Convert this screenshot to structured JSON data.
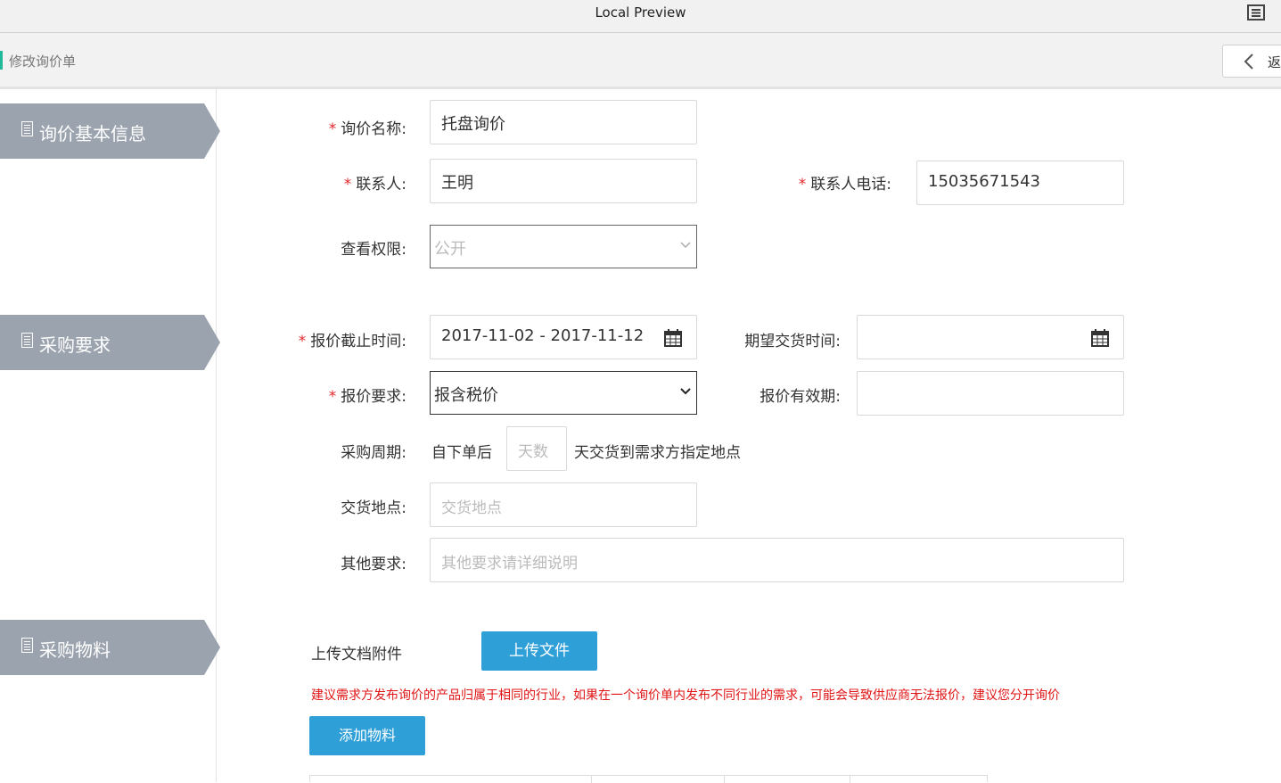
{
  "window": {
    "title": "Local Preview",
    "menu_icon": "list-icon"
  },
  "page": {
    "title": "修改询价单",
    "back_label": "返回"
  },
  "sections": {
    "basic": "询价基本信息",
    "requirements": "采购要求",
    "materials": "采购物料"
  },
  "form": {
    "inquiry_name": {
      "label": "询价名称:",
      "value": "托盘询价"
    },
    "contact": {
      "label": "联系人:",
      "value": "王明"
    },
    "contact_phone": {
      "label": "联系人电话:",
      "value": "15035671543"
    },
    "visibility": {
      "label": "查看权限:",
      "value": "公开"
    },
    "quote_deadline": {
      "label": "报价截止时间:",
      "value": "2017-11-02 - 2017-11-12"
    },
    "expected_delivery": {
      "label": "期望交货时间:",
      "value": ""
    },
    "quote_requirement": {
      "label": "报价要求:",
      "value": "报含税价"
    },
    "quote_validity": {
      "label": "报价有效期:",
      "value": ""
    },
    "purchase_cycle": {
      "label": "采购周期:",
      "prefix": "自下单后",
      "placeholder": "天数",
      "suffix": "天交货到需求方指定地点"
    },
    "delivery_place": {
      "label": "交货地点:",
      "placeholder": "交货地点"
    },
    "other_requirements": {
      "label": "其他要求:",
      "placeholder": "其他要求请详细说明"
    }
  },
  "materials": {
    "upload_label": "上传文档附件",
    "upload_button": "上传文件",
    "warning": "建议需求方发布询价的产品归属于相同的行业，如果在一个询价单内发布不同行业的需求，可能会导致供应商无法报价，建议您分开询价",
    "add_button": "添加物料"
  },
  "colors": {
    "accent": "#22b99a",
    "button": "#2f9fd8",
    "required": "#e0262b",
    "warning": "#e01414",
    "tab": "#9aa3ae"
  }
}
